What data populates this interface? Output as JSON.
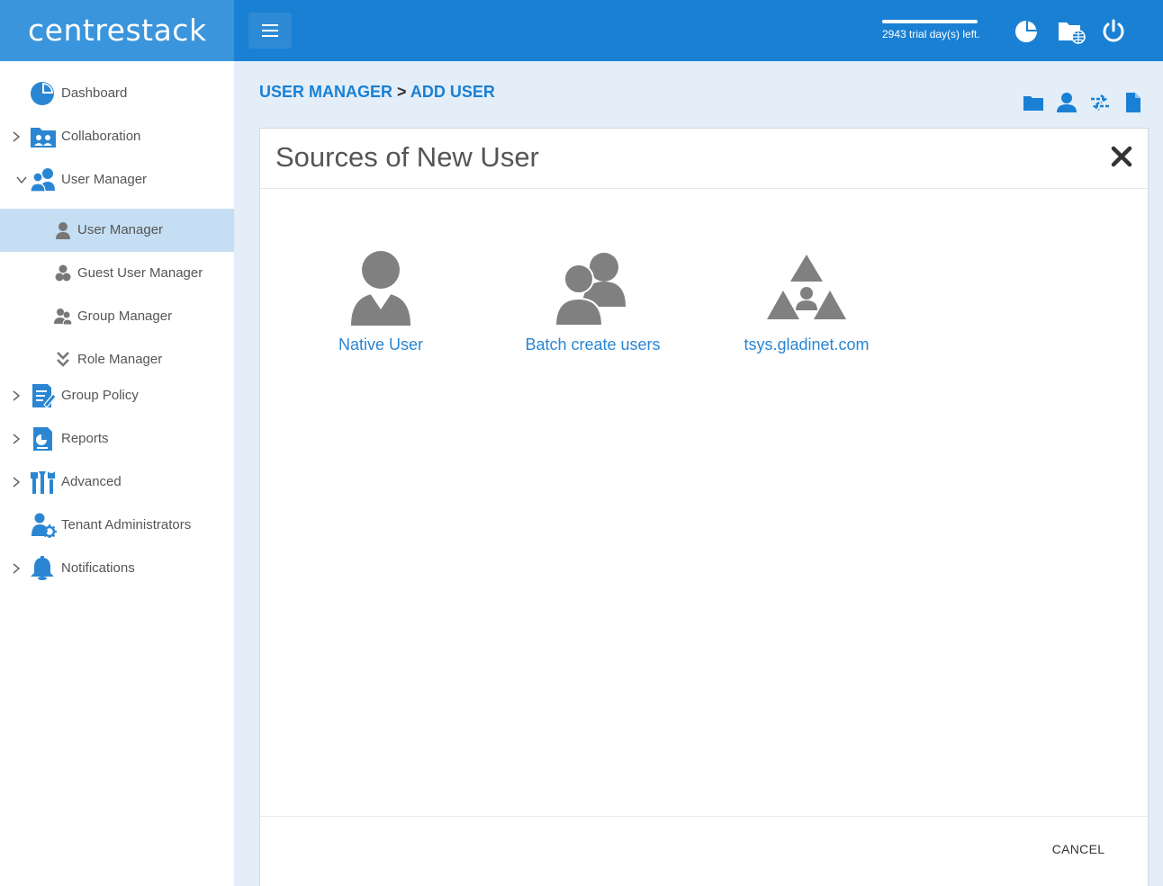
{
  "app": {
    "logo_text": "centrestack",
    "trial_text": "2943 trial day(s) left."
  },
  "colors": {
    "topbar": "#1a80d4",
    "logo_bg": "#3b95dc",
    "accent": "#1a80d4",
    "sidebar_active": "#c5def3",
    "icon_gray": "#808080"
  },
  "topbar": {
    "icons": [
      "dashboard-pie-icon",
      "folder-globe-icon",
      "power-icon"
    ]
  },
  "sidebar": {
    "items": [
      {
        "label": "Dashboard",
        "icon": "dashboard-pie-icon",
        "expandable": false
      },
      {
        "label": "Collaboration",
        "icon": "collaboration-folder-icon",
        "expandable": true
      },
      {
        "label": "User Manager",
        "icon": "users-icon",
        "expandable": true,
        "expanded": true
      },
      {
        "label": "User Manager",
        "icon": "user-icon",
        "sub": true,
        "active": true
      },
      {
        "label": "Guest User Manager",
        "icon": "guest-user-icon",
        "sub": true
      },
      {
        "label": "Group Manager",
        "icon": "group-icon",
        "sub": true
      },
      {
        "label": "Role Manager",
        "icon": "role-chevrons-icon",
        "sub": true
      },
      {
        "label": "Group Policy",
        "icon": "group-policy-icon",
        "expandable": true
      },
      {
        "label": "Reports",
        "icon": "reports-icon",
        "expandable": true
      },
      {
        "label": "Advanced",
        "icon": "advanced-tools-icon",
        "expandable": true
      },
      {
        "label": "Tenant Administrators",
        "icon": "tenant-admin-icon",
        "expandable": false
      },
      {
        "label": "Notifications",
        "icon": "bell-icon",
        "expandable": true
      }
    ]
  },
  "breadcrumb": {
    "part1": "USER MANAGER",
    "separator": " > ",
    "part2": "ADD USER"
  },
  "toolbar": {
    "icons": [
      "folder-icon",
      "user-icon",
      "transfer-arrows-icon",
      "document-icon"
    ]
  },
  "dialog": {
    "title": "Sources of New User",
    "sources": [
      {
        "label": "Native User",
        "icon": "native-user-icon"
      },
      {
        "label": "Batch create users",
        "icon": "batch-users-icon"
      },
      {
        "label": "tsys.gladinet.com",
        "icon": "domain-triangles-icon"
      }
    ],
    "cancel_label": "CANCEL"
  }
}
